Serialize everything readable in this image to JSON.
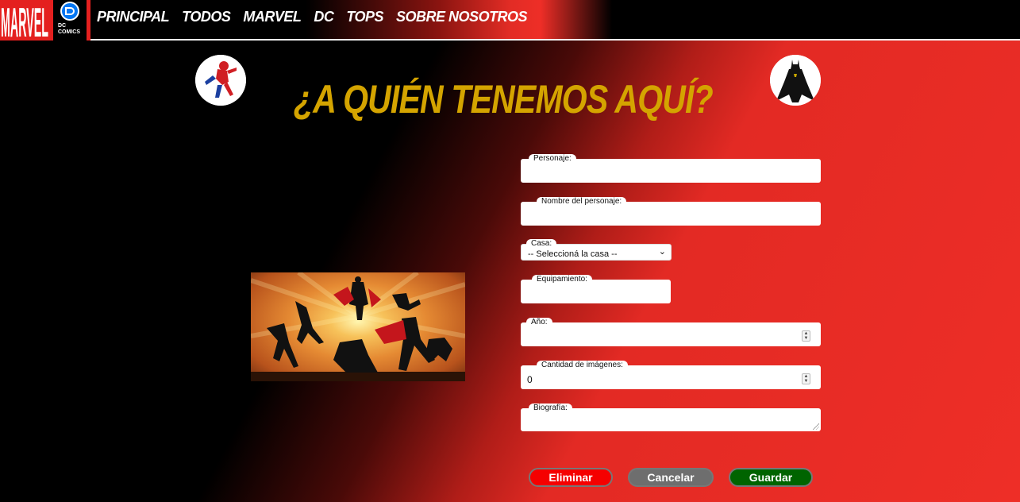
{
  "navbar": {
    "brand_marvel": "MARVEL",
    "brand_dc": "DC COMICS",
    "links": [
      "PRINCIPAL",
      "TODOS",
      "MARVEL",
      "DC",
      "TOPS",
      "SOBRE NOSOTROS"
    ]
  },
  "header": {
    "title": "¿A QUIÉN TENEMOS AQUÍ?"
  },
  "form": {
    "personaje_label": "Personaje:",
    "personaje_value": "",
    "nombre_label": "Nombre del personaje:",
    "nombre_value": "",
    "casa_label": "Casa:",
    "casa_selected": "-- Seleccioná la casa --",
    "equipamiento_label": "Equipamiento:",
    "equipamiento_value": "",
    "anio_label": "Año:",
    "anio_value": "",
    "cantidad_label": "Cantidad de imágenes:",
    "cantidad_value": "0",
    "biografia_label": "Biografía:",
    "biografia_value": ""
  },
  "actions": {
    "delete_label": "Eliminar",
    "cancel_label": "Cancelar",
    "save_label": "Guardar"
  },
  "colors": {
    "title": "#d4a400",
    "delete": "#f50000",
    "cancel": "#6e6e6e",
    "save": "#006400",
    "background_red": "#ee2e27"
  },
  "icons": {
    "spiderman": "spiderman-avatar-icon",
    "batman": "batman-avatar-icon",
    "select_chevron": "chevron-down-icon"
  }
}
